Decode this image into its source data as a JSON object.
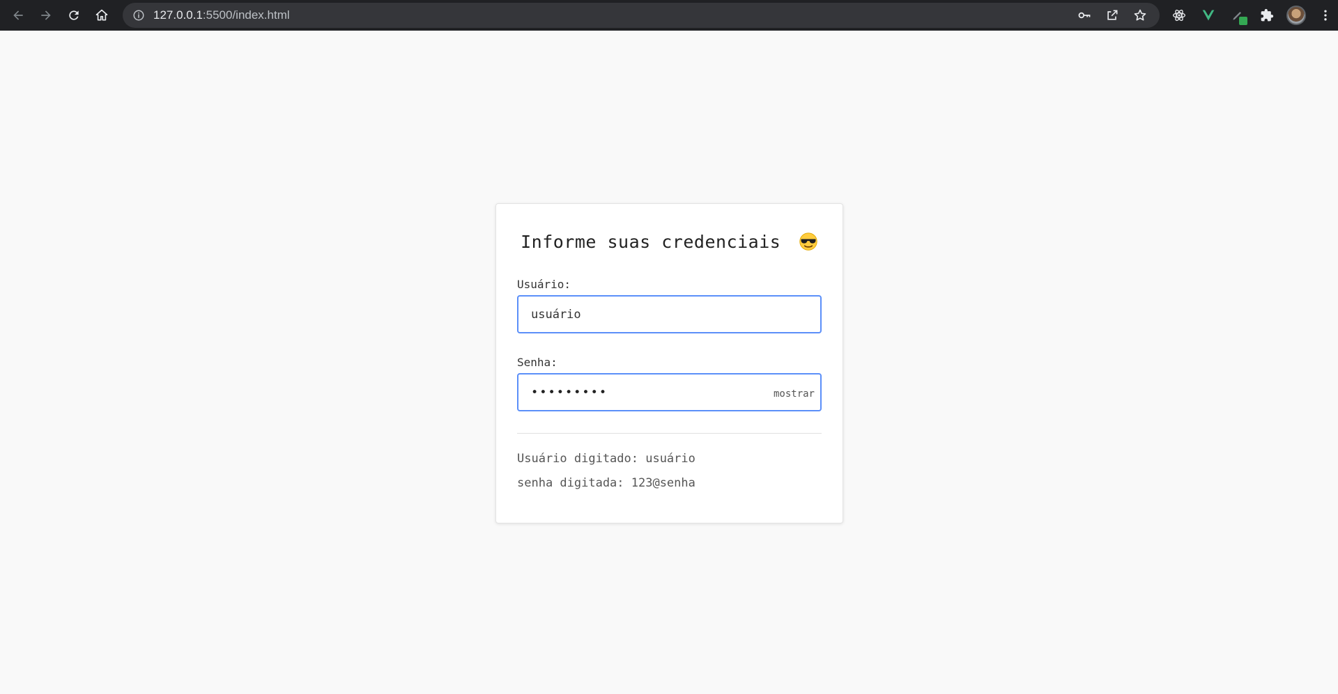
{
  "browser": {
    "url_host": "127.0.0.1",
    "url_rest": ":5500/index.html"
  },
  "icons": {
    "back": "arrow-left-icon",
    "forward": "arrow-right-icon",
    "reload": "reload-icon",
    "home": "home-icon",
    "site_info": "info-icon",
    "password": "key-icon",
    "share": "share-icon",
    "bookmark": "star-icon",
    "react_devtools": "react-icon",
    "vue_devtools": "vue-icon",
    "extension_pen": "pen-icon",
    "extensions": "puzzle-icon",
    "profile": "avatar",
    "menu": "kebab-menu-icon"
  },
  "form": {
    "title": "Informe suas credenciais",
    "user_label": "Usuário:",
    "user_value": "usuário",
    "pass_label": "Senha:",
    "pass_masked": "•••••••••",
    "show_label": "mostrar"
  },
  "result": {
    "user_line": "Usuário digitado: usuário",
    "pass_line": "senha digitada: 123@senha"
  },
  "colors": {
    "input_border": "#5b8ff9",
    "chrome_bg": "#202124",
    "page_bg": "#f9f9f9"
  }
}
